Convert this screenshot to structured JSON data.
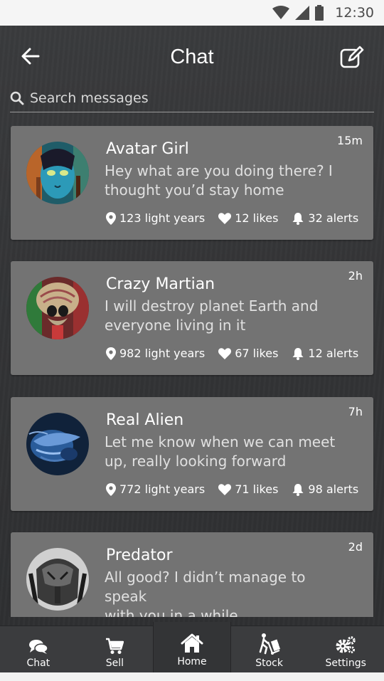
{
  "status_bar": {
    "time": "12:30"
  },
  "header": {
    "title": "Chat"
  },
  "search": {
    "placeholder": "Search messages"
  },
  "chats": [
    {
      "name": "Avatar Girl",
      "time": "15m",
      "message": "Hey what are you doing there? I thought you’d stay home",
      "distance": "123 light years",
      "likes": "12 likes",
      "alerts": "32 alerts"
    },
    {
      "name": "Crazy Martian",
      "time": "2h",
      "message": "I will destroy planet Earth and everyone living in it",
      "distance": "982 light years",
      "likes": "67 likes",
      "alerts": "12 alerts"
    },
    {
      "name": "Real Alien",
      "time": "7h",
      "message": "Let me know when we can meet up, really looking forward",
      "distance": "772 light years",
      "likes": "71 likes",
      "alerts": "98 alerts"
    },
    {
      "name": "Predator",
      "time": "2d",
      "message": "All good? I didn’t manage to speak\nwith you in a while",
      "distance": "",
      "likes": "",
      "alerts": ""
    }
  ],
  "nav": [
    {
      "label": "Chat",
      "icon": "chat-icon"
    },
    {
      "label": "Sell",
      "icon": "cart-icon"
    },
    {
      "label": "Home",
      "icon": "home-icon",
      "active": true
    },
    {
      "label": "Stock",
      "icon": "hand-truck-icon"
    },
    {
      "label": "Settings",
      "icon": "gears-icon"
    }
  ]
}
